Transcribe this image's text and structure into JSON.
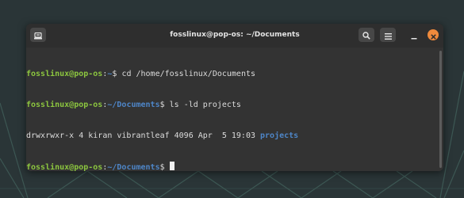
{
  "window": {
    "title": "fosslinux@pop-os: ~/Documents"
  },
  "icons": {
    "new_tab": "terminal-tab-icon",
    "search": "search-icon",
    "menu": "hamburger-menu-icon",
    "minimize": "minimize-icon",
    "close": "close-icon"
  },
  "colors": {
    "prompt_user": "#8cc63f",
    "prompt_path": "#4e86c8",
    "close_button": "#f08a3c",
    "terminal_bg": "#333333"
  },
  "terminal": {
    "lines": [
      {
        "user": "fosslinux@pop-os",
        "sep": ":",
        "path": "~",
        "symbol": "$ ",
        "command": "cd /home/fosslinux/Documents"
      },
      {
        "user": "fosslinux@pop-os",
        "sep": ":",
        "path": "~/Documents",
        "symbol": "$ ",
        "command": "ls -ld projects"
      },
      {
        "output": "drwxrwxr-x 4 kiran vibrantleaf 4096 Apr  5 19:03 ",
        "dirname": "projects"
      },
      {
        "user": "fosslinux@pop-os",
        "sep": ":",
        "path": "~/Documents",
        "symbol": "$ "
      }
    ]
  }
}
